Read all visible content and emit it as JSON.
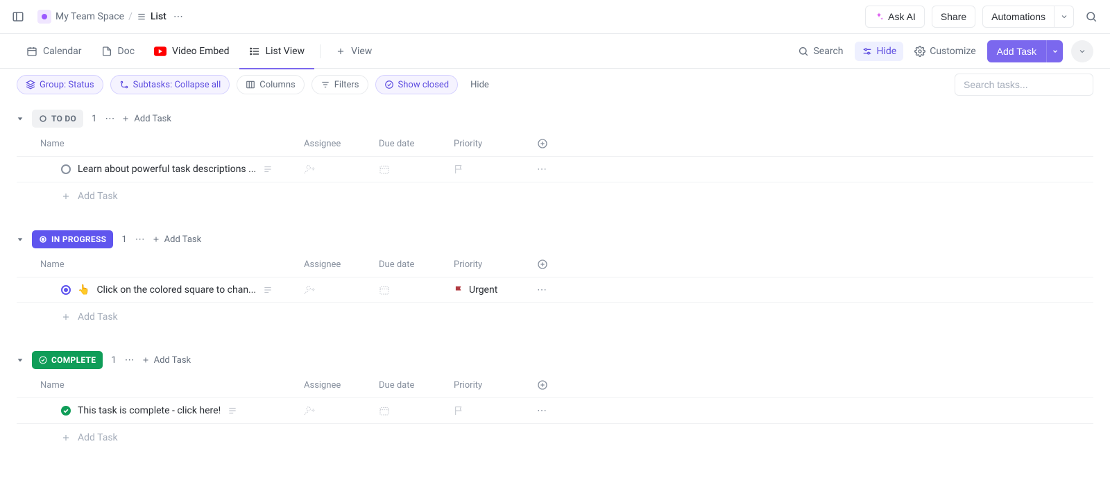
{
  "breadcrumb": {
    "space_name": "My Team Space",
    "list_name": "List"
  },
  "topbar": {
    "ask_ai": "Ask AI",
    "share": "Share",
    "automations": "Automations"
  },
  "views": {
    "calendar": "Calendar",
    "doc": "Doc",
    "video_embed": "Video Embed",
    "list_view": "List View",
    "add_view": "View"
  },
  "toolbar": {
    "search": "Search",
    "hide": "Hide",
    "customize": "Customize",
    "add_task": "Add Task"
  },
  "filters": {
    "group": "Group: Status",
    "subtasks": "Subtasks: Collapse all",
    "columns": "Columns",
    "filters": "Filters",
    "show_closed": "Show closed",
    "hide": "Hide",
    "search_placeholder": "Search tasks..."
  },
  "columns": {
    "name": "Name",
    "assignee": "Assignee",
    "due": "Due date",
    "priority": "Priority"
  },
  "groups": [
    {
      "id": "todo",
      "label": "TO DO",
      "count": "1",
      "add_label": "Add Task",
      "tasks": [
        {
          "title": "Learn about powerful task descriptions ...",
          "priority": "",
          "has_emoji": false,
          "has_desc": true
        }
      ]
    },
    {
      "id": "inprogress",
      "label": "IN PROGRESS",
      "count": "1",
      "add_label": "Add Task",
      "tasks": [
        {
          "title": "Click on the colored square to chan...",
          "priority": "Urgent",
          "has_emoji": true,
          "has_desc": true
        }
      ]
    },
    {
      "id": "complete",
      "label": "COMPLETE",
      "count": "1",
      "add_label": "Add Task",
      "tasks": [
        {
          "title": "This task is complete - click here!",
          "priority": "",
          "has_emoji": false,
          "has_desc": true
        }
      ]
    }
  ],
  "add_task_inline": "Add Task",
  "priority_labels": {
    "urgent": "Urgent"
  },
  "emoji": {
    "pointer": "👆"
  }
}
